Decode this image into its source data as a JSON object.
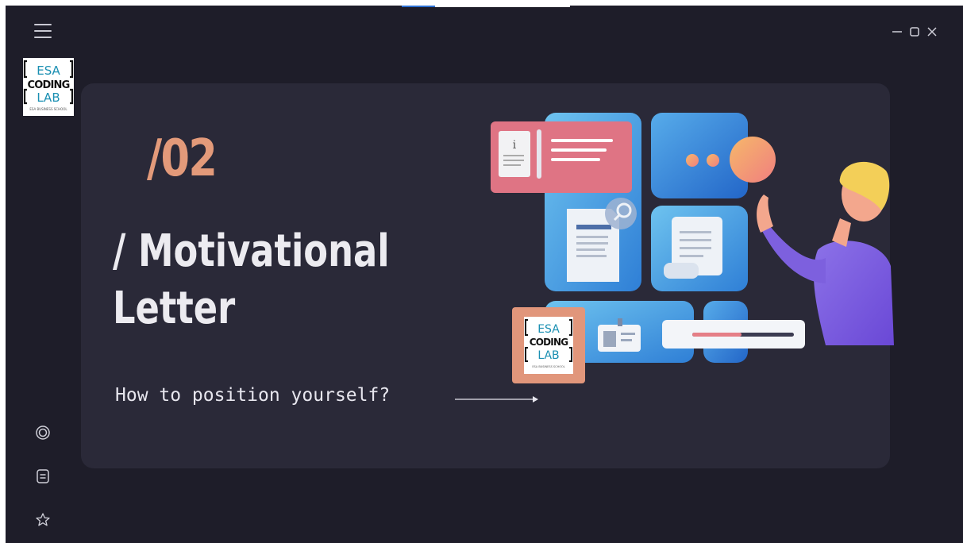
{
  "window": {
    "menu_icon": "hamburger-menu-icon",
    "controls": [
      "minimize-icon",
      "maximize-icon",
      "close-icon"
    ]
  },
  "logo": {
    "lines": [
      "ESA",
      "CODING",
      "LAB"
    ],
    "tagline": "ESA BUSINESS SCHOOL"
  },
  "slide": {
    "number": "/02",
    "title_line1": "/ Motivational",
    "title_line2": "Letter",
    "subtitle": "How to position yourself?"
  },
  "sidebar": {
    "icons": [
      "target-icon",
      "document-icon",
      "star-icon"
    ]
  },
  "colors": {
    "background": "#1e1d29",
    "card": "#2a2938",
    "accent": "#e39a7a",
    "text": "#ecebf0"
  }
}
